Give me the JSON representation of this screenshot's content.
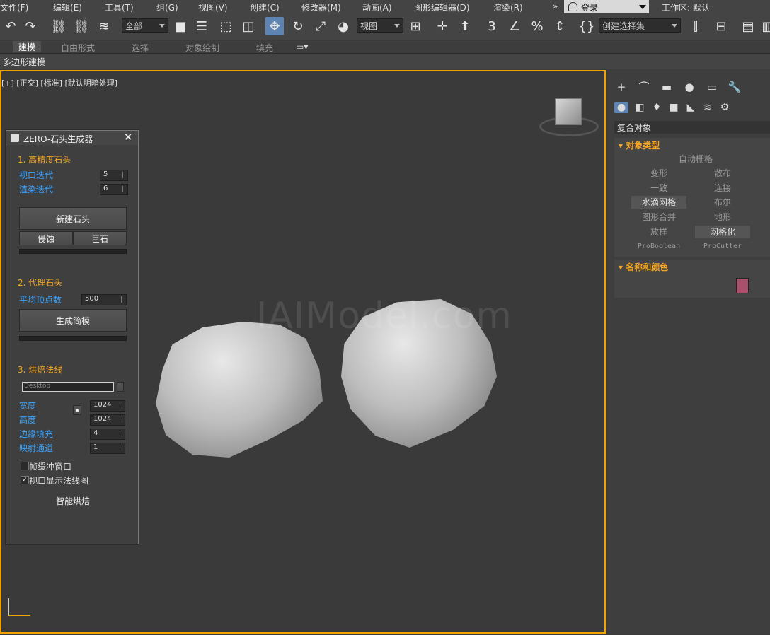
{
  "menu": {
    "items": [
      "文件(F)",
      "编辑(E)",
      "工具(T)",
      "组(G)",
      "视图(V)",
      "创建(C)",
      "修改器(M)",
      "动画(A)",
      "图形编辑器(D)",
      "渲染(R)"
    ],
    "overflow": "»",
    "login_label": "登录",
    "workspace_label": "工作区: 默认"
  },
  "toolbar": {
    "selection_filter": "全部",
    "reference_coord": "视图",
    "named_selection": "创建选择集"
  },
  "ribbon": {
    "tabs": [
      "建模",
      "自由形式",
      "选择",
      "对象绘制",
      "填充"
    ],
    "active_tab": "建模",
    "sub_label": "多边形建模"
  },
  "viewport": {
    "label": "[+] [正交] [标准] [默认明暗处理]",
    "watermark": "IAIModel.com"
  },
  "tool_panel": {
    "title": "ZERO-石头生成器",
    "close": "×",
    "section1": {
      "title": "1. 高精度石头",
      "viewport_iter_label": "视口迭代",
      "viewport_iter_value": "5",
      "render_iter_label": "渲染迭代",
      "render_iter_value": "6",
      "new_rock_button": "新建石头",
      "erode_button": "侵蚀",
      "boulder_button": "巨石"
    },
    "section2": {
      "title": "2. 代理石头",
      "avg_vertices_label": "平均顶点数",
      "avg_vertices_value": "500",
      "gen_simple_button": "生成简模"
    },
    "section3": {
      "title": "3. 烘焙法线",
      "path_value": "Desktop",
      "width_label": "宽度",
      "width_value": "1024",
      "height_label": "高度",
      "height_value": "1024",
      "padding_label": "边缘填充",
      "padding_value": "4",
      "channel_label": "映射通道",
      "channel_value": "1",
      "frame_buffer_label": "帧缓冲窗口",
      "frame_buffer_checked": false,
      "show_normal_label": "视口显示法线图",
      "show_normal_checked": true,
      "smart_bake_button": "智能烘焙"
    }
  },
  "command_panel": {
    "category": "复合对象",
    "object_type_title": "对象类型",
    "auto_grid": "自动栅格",
    "objects": [
      {
        "label": "变形",
        "enabled": false
      },
      {
        "label": "散布",
        "enabled": false
      },
      {
        "label": "一致",
        "enabled": false
      },
      {
        "label": "连接",
        "enabled": false
      },
      {
        "label": "水滴网格",
        "enabled": true
      },
      {
        "label": "布尔",
        "enabled": false
      },
      {
        "label": "图形合并",
        "enabled": false
      },
      {
        "label": "地形",
        "enabled": false
      },
      {
        "label": "放样",
        "enabled": false
      },
      {
        "label": "网格化",
        "enabled": true
      },
      {
        "label": "ProBoolean",
        "enabled": false
      },
      {
        "label": "ProCutter",
        "enabled": false
      }
    ],
    "name_color_title": "名称和颜色",
    "object_color": "#a8506c"
  },
  "colors": {
    "accent_orange": "#f1a300",
    "label_blue": "#3aa3ff",
    "active_blue": "#5d84b3"
  }
}
